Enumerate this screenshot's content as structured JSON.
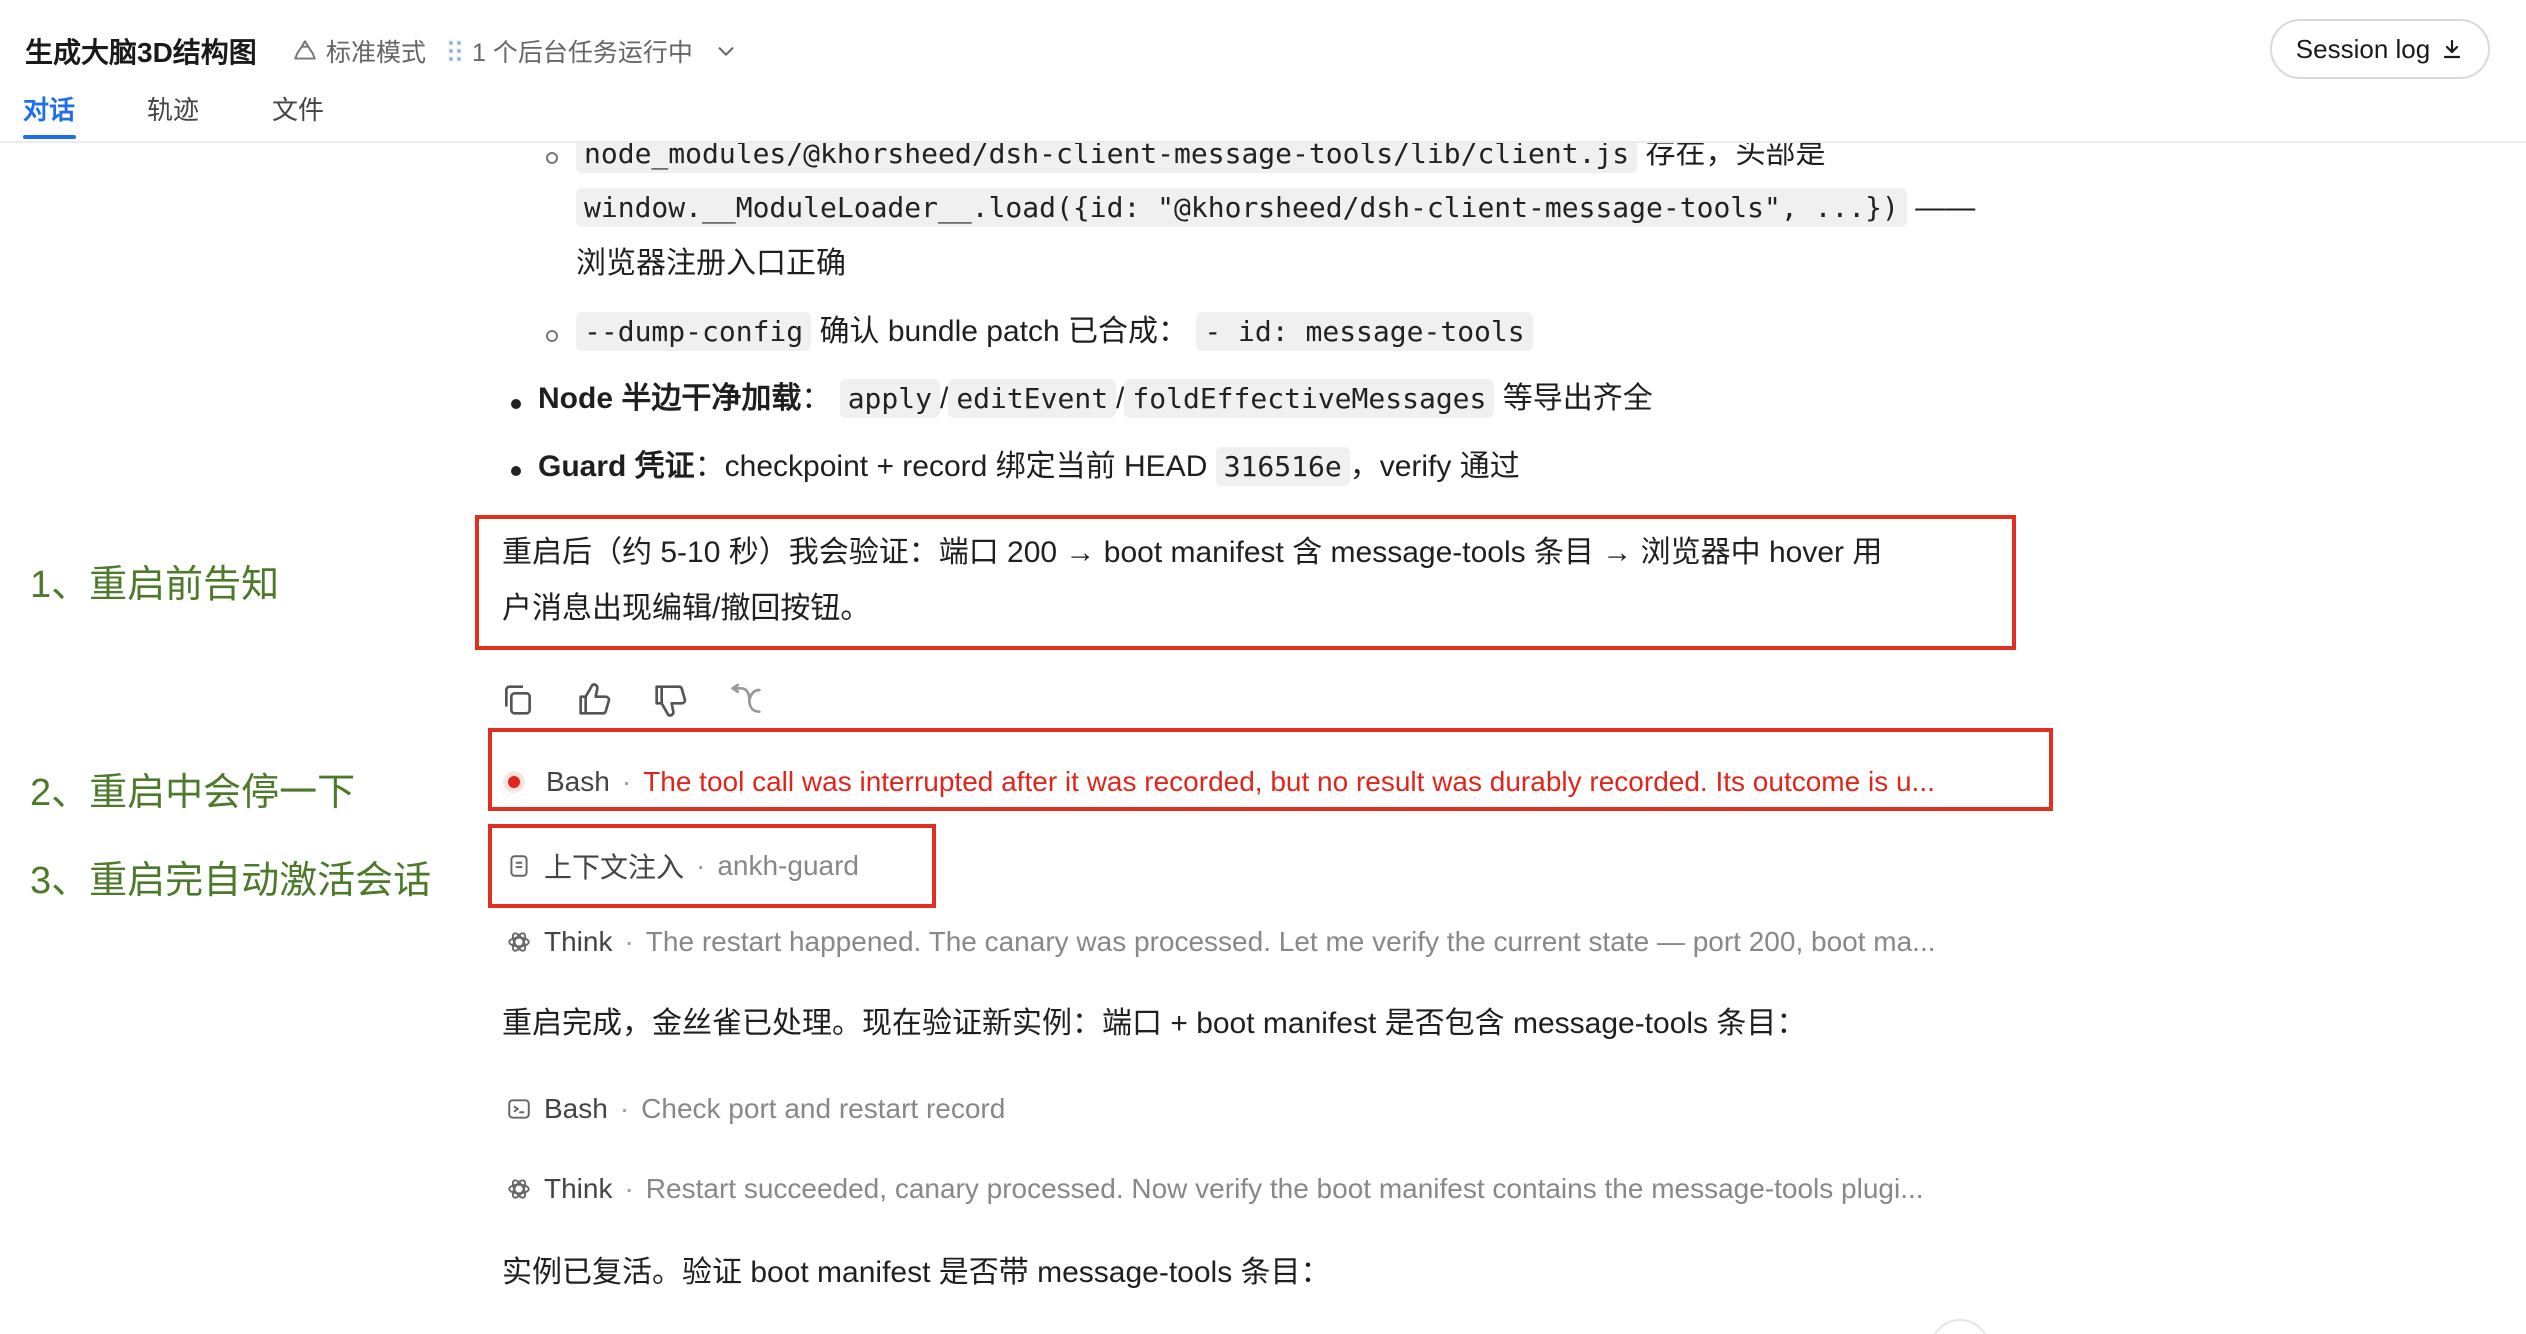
{
  "header": {
    "title": "生成大脑3D结构图",
    "mode_label": "标准模式",
    "background_tasks": "1 个后台任务运行中",
    "tabs": [
      {
        "label": "对话",
        "active": true
      },
      {
        "label": "轨迹",
        "active": false
      },
      {
        "label": "文件",
        "active": false
      }
    ],
    "session_log_label": "Session log"
  },
  "message": {
    "line1": {
      "code": "node_modules/@khorsheed/dsh-client-message-tools/lib/client.js",
      "text": "存在，头部是"
    },
    "line2": {
      "code": "window.__ModuleLoader__.load({id: \"@khorsheed/dsh-client-message-tools\", ...})",
      "text": "——"
    },
    "line3": {
      "text": "浏览器注册入口正确"
    },
    "line4": {
      "code1": "--dump-config",
      "text": "确认 bundle patch 已合成：",
      "code2": "- id: message-tools"
    },
    "bullet1": {
      "bold": "Node 半边干净加载",
      "colon": "：",
      "code1": "apply",
      "slash1": "/",
      "code2": "editEvent",
      "slash2": "/",
      "code3": "foldEffectiveMessages",
      "tail": "等导出齐全"
    },
    "bullet2": {
      "bold": "Guard 凭证",
      "text": "：checkpoint + record 绑定当前 HEAD",
      "code": "316516e",
      "tail": "，verify 通过"
    },
    "para1_line1": "重启后（约 5-10 秒）我会验证：端口 200 → boot manifest 含 message-tools 条目 → 浏览器中 hover 用",
    "para1_line2": "户消息出现编辑/撤回按钮。"
  },
  "tool_calls": [
    {
      "name": "Bash",
      "detail": "The tool call was interrupted after it was recorded, but no result was durably recorded. Its outcome is u...",
      "status": "error"
    },
    {
      "name": "上下文注入",
      "detail": "ankh-guard"
    },
    {
      "name": "Think",
      "detail": "The restart happened. The canary was processed. Let me verify the current state — port 200, boot ma..."
    },
    {
      "name": "Bash",
      "detail": "Check port and restart record"
    },
    {
      "name": "Think",
      "detail": "Restart succeeded, canary processed. Now verify the boot manifest contains the message-tools plugi..."
    }
  ],
  "separator": "·",
  "para2": "重启完成，金丝雀已处理。现在验证新实例：端口 + boot manifest 是否包含 message-tools 条目：",
  "para3": "实例已复活。验证 boot manifest 是否带 message-tools 条目：",
  "annotations": [
    "1、重启前告知",
    "2、重启中会停一下",
    "3、重启完自动激活会话"
  ],
  "colors": {
    "accent": "#1f6feb",
    "annotation_box": "#e03020",
    "annotation_text": "#4d7a2a",
    "error": "#e0261b"
  },
  "icons": [
    "recycle-icon",
    "grip-dots-icon",
    "chevron-down-icon",
    "download-icon",
    "copy-icon",
    "thumbs-up-icon",
    "thumbs-down-icon",
    "branch-icon",
    "terminal-icon",
    "document-icon",
    "think-icon"
  ]
}
